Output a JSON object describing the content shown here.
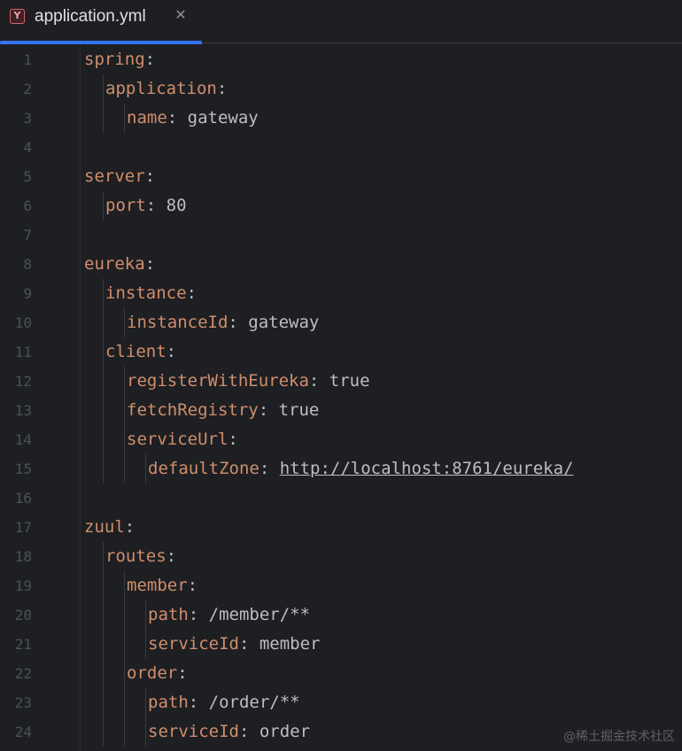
{
  "tab": {
    "icon_letter": "Y",
    "title": "application.yml",
    "close_glyph": "✕"
  },
  "lines": [
    {
      "n": "1",
      "indent": 0,
      "key": "spring",
      "sep": ":",
      "value": ""
    },
    {
      "n": "2",
      "indent": 1,
      "key": "application",
      "sep": ":",
      "value": ""
    },
    {
      "n": "3",
      "indent": 2,
      "key": "name",
      "sep": ": ",
      "value": "gateway"
    },
    {
      "n": "4",
      "indent": 0,
      "key": "",
      "sep": "",
      "value": ""
    },
    {
      "n": "5",
      "indent": 0,
      "key": "server",
      "sep": ":",
      "value": ""
    },
    {
      "n": "6",
      "indent": 1,
      "key": "port",
      "sep": ": ",
      "value": "80"
    },
    {
      "n": "7",
      "indent": 0,
      "key": "",
      "sep": "",
      "value": ""
    },
    {
      "n": "8",
      "indent": 0,
      "key": "eureka",
      "sep": ":",
      "value": ""
    },
    {
      "n": "9",
      "indent": 1,
      "key": "instance",
      "sep": ":",
      "value": ""
    },
    {
      "n": "10",
      "indent": 2,
      "key": "instanceId",
      "sep": ": ",
      "value": "gateway"
    },
    {
      "n": "11",
      "indent": 1,
      "key": "client",
      "sep": ":",
      "value": ""
    },
    {
      "n": "12",
      "indent": 2,
      "key": "registerWithEureka",
      "sep": ": ",
      "value": "true"
    },
    {
      "n": "13",
      "indent": 2,
      "key": "fetchRegistry",
      "sep": ": ",
      "value": "true"
    },
    {
      "n": "14",
      "indent": 2,
      "key": "serviceUrl",
      "sep": ":",
      "value": ""
    },
    {
      "n": "15",
      "indent": 3,
      "key": "defaultZone",
      "sep": ": ",
      "value": "http://localhost:8761/eureka/",
      "link": true
    },
    {
      "n": "16",
      "indent": 0,
      "key": "",
      "sep": "",
      "value": ""
    },
    {
      "n": "17",
      "indent": 0,
      "key": "zuul",
      "sep": ":",
      "value": ""
    },
    {
      "n": "18",
      "indent": 1,
      "key": "routes",
      "sep": ":",
      "value": ""
    },
    {
      "n": "19",
      "indent": 2,
      "key": "member",
      "sep": ":",
      "value": ""
    },
    {
      "n": "20",
      "indent": 3,
      "key": "path",
      "sep": ": ",
      "value": "/member/**"
    },
    {
      "n": "21",
      "indent": 3,
      "key": "serviceId",
      "sep": ": ",
      "value": "member"
    },
    {
      "n": "22",
      "indent": 2,
      "key": "order",
      "sep": ":",
      "value": ""
    },
    {
      "n": "23",
      "indent": 3,
      "key": "path",
      "sep": ": ",
      "value": "/order/**"
    },
    {
      "n": "24",
      "indent": 3,
      "key": "serviceId",
      "sep": ": ",
      "value": "order"
    }
  ],
  "watermark": "@稀土掘金技术社区",
  "colors": {
    "background": "#1e1f22",
    "key": "#cf8e6d",
    "value": "#bcbec4",
    "line_number": "#4b5059",
    "tab_accent": "#3574f0"
  }
}
